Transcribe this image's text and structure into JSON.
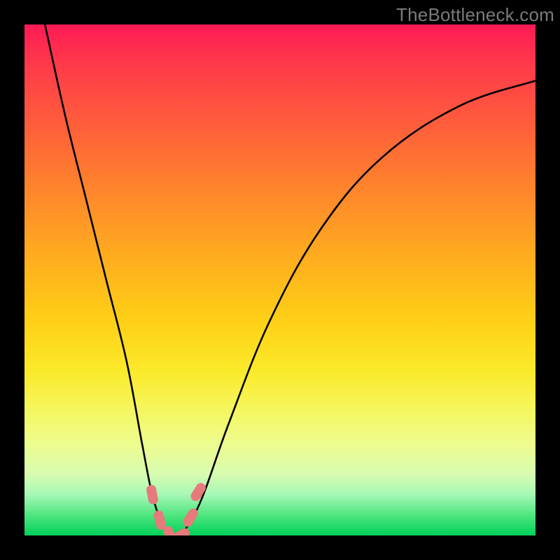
{
  "watermark": "TheBottleneck.com",
  "chart_data": {
    "type": "line",
    "title": "",
    "xlabel": "",
    "ylabel": "",
    "xlim": [
      0,
      100
    ],
    "ylim": [
      0,
      100
    ],
    "series": [
      {
        "name": "bottleneck-curve",
        "x": [
          4,
          8,
          12,
          16,
          20,
          23,
          25,
          27,
          28.5,
          30,
          32,
          35,
          40,
          48,
          58,
          70,
          85,
          100
        ],
        "values": [
          100,
          82,
          66,
          50,
          34,
          18,
          8,
          2,
          0,
          0,
          2,
          8,
          22,
          42,
          60,
          74,
          84,
          89
        ]
      }
    ],
    "markers": [
      {
        "name": "left-marker-upper",
        "x": 25.0,
        "y": 8.0
      },
      {
        "name": "left-marker-lower",
        "x": 26.5,
        "y": 3.0
      },
      {
        "name": "trough-left",
        "x": 28.5,
        "y": 0.0
      },
      {
        "name": "trough-right",
        "x": 30.5,
        "y": 0.0
      },
      {
        "name": "right-marker-lower",
        "x": 32.5,
        "y": 3.5
      },
      {
        "name": "right-marker-upper",
        "x": 34.0,
        "y": 8.5
      }
    ],
    "marker_color": "#e77a7a",
    "curve_color": "#000000"
  }
}
